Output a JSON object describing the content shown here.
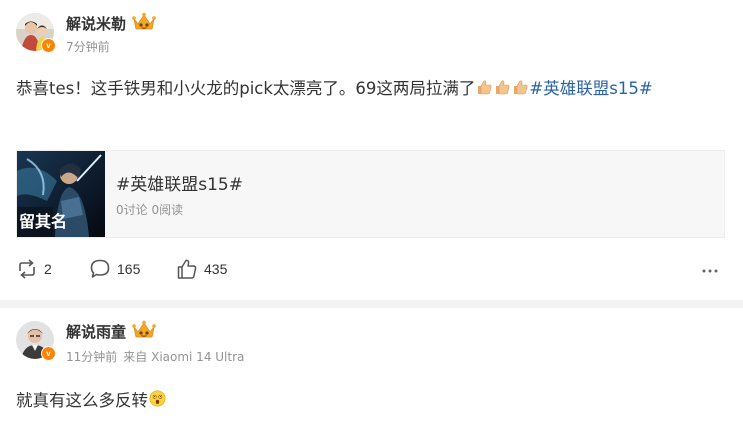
{
  "posts": [
    {
      "username": "解说米勒",
      "time": "7分钟前",
      "text": "恭喜tes！这手铁男和小火龙的pick太漂亮了。69这两局拉满了",
      "hashtag": "#英雄联盟s15#",
      "card": {
        "title": "#英雄联盟s15#",
        "stats": "0讨论 0阅读",
        "image_text": "留其名"
      },
      "actions": {
        "reposts": "2",
        "comments": "165",
        "likes": "435"
      }
    },
    {
      "username": "解说雨童",
      "time": "11分钟前",
      "source": "来自 Xiaomi 14 Ultra",
      "text": "就真有这么多反转"
    }
  ],
  "icons": {
    "verified_badge": "v-badge-icon",
    "crown": "crown-icon",
    "thumbs_up": "thumbs-up-emoji",
    "shocked": "shocked-face-emoji",
    "repost": "repost-icon",
    "comment": "comment-icon",
    "like": "like-icon",
    "more": "more-icon"
  },
  "colors": {
    "hashtag": "#2a61a7",
    "meta": "#939393",
    "text": "#333333",
    "verified": "#ff8200",
    "crown": "#f5a623"
  }
}
